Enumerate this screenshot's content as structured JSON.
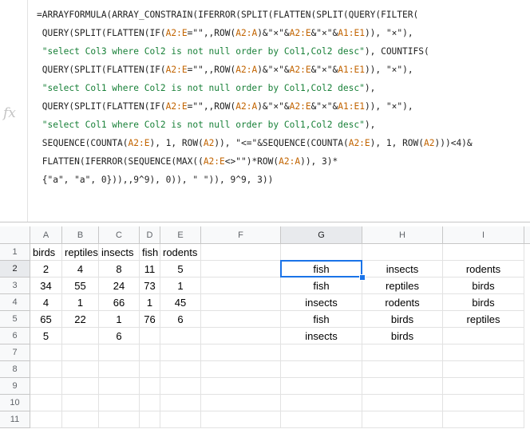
{
  "formula_lines": [
    [
      [
        "t",
        "=ARRAYFORMULA(ARRAY_CONSTRAIN(IFERROR(SPLIT(FLATTEN(SPLIT(QUERY(FILTER("
      ]
    ],
    [
      [
        "t",
        " QUERY(SPLIT(FLATTEN(IF("
      ],
      [
        "r",
        "A2:E"
      ],
      [
        "t",
        "=\"\",,ROW("
      ],
      [
        "r",
        "A2:A"
      ],
      [
        "t",
        ")&\"×\"&"
      ],
      [
        "r",
        "A2:E"
      ],
      [
        "t",
        "&\"×\"&"
      ],
      [
        "r",
        "A1:E1"
      ],
      [
        "t",
        ")), \"×\"),"
      ]
    ],
    [
      [
        "s",
        " \"select Col3 where Col2 is not null order by Col1,Col2 desc\""
      ],
      [
        "t",
        "), COUNTIFS("
      ]
    ],
    [
      [
        "t",
        " QUERY(SPLIT(FLATTEN(IF("
      ],
      [
        "r",
        "A2:E"
      ],
      [
        "t",
        "=\"\",,ROW("
      ],
      [
        "r",
        "A2:A"
      ],
      [
        "t",
        ")&\"×\"&"
      ],
      [
        "r",
        "A2:E"
      ],
      [
        "t",
        "&\"×\"&"
      ],
      [
        "r",
        "A1:E1"
      ],
      [
        "t",
        ")), \"×\"),"
      ]
    ],
    [
      [
        "s",
        " \"select Col1 where Col2 is not null order by Col1,Col2 desc\""
      ],
      [
        "t",
        "),"
      ]
    ],
    [
      [
        "t",
        " QUERY(SPLIT(FLATTEN(IF("
      ],
      [
        "r",
        "A2:E"
      ],
      [
        "t",
        "=\"\",,ROW("
      ],
      [
        "r",
        "A2:A"
      ],
      [
        "t",
        ")&\"×\"&"
      ],
      [
        "r",
        "A2:E"
      ],
      [
        "t",
        "&\"×\"&"
      ],
      [
        "r",
        "A1:E1"
      ],
      [
        "t",
        ")), \"×\"),"
      ]
    ],
    [
      [
        "s",
        " \"select Col1 where Col2 is not null order by Col1,Col2 desc\""
      ],
      [
        "t",
        "),"
      ]
    ],
    [
      [
        "t",
        " SEQUENCE(COUNTA("
      ],
      [
        "r",
        "A2:E"
      ],
      [
        "t",
        "), 1, ROW("
      ],
      [
        "r",
        "A2"
      ],
      [
        "t",
        ")), \"<=\"&SEQUENCE(COUNTA("
      ],
      [
        "r",
        "A2:E"
      ],
      [
        "t",
        "), 1, ROW("
      ],
      [
        "r",
        "A2"
      ],
      [
        "t",
        ")))<4)&"
      ]
    ],
    [
      [
        "t",
        " FLATTEN(IFERROR(SEQUENCE(MAX(("
      ],
      [
        "r",
        "A2:E"
      ],
      [
        "t",
        "<>\"\")*ROW("
      ],
      [
        "r",
        "A2:A"
      ],
      [
        "t",
        ")), 3)*"
      ]
    ],
    [
      [
        "t",
        " {\"a\", \"a\", 0})),,9^9), 0)), \" \")), 9^9, 3))"
      ]
    ]
  ],
  "fx_label": "fx",
  "columns": [
    "A",
    "B",
    "C",
    "D",
    "E",
    "F",
    "G",
    "H",
    "I"
  ],
  "rows": [
    "1",
    "2",
    "3",
    "4",
    "5",
    "6",
    "7",
    "8",
    "9",
    "10",
    "11"
  ],
  "cells": [
    [
      "birds",
      "reptiles",
      "insects",
      "fish",
      "rodents",
      "",
      "",
      "",
      ""
    ],
    [
      "2",
      "4",
      "8",
      "11",
      "5",
      "",
      "fish",
      "insects",
      "rodents"
    ],
    [
      "34",
      "55",
      "24",
      "73",
      "1",
      "",
      "fish",
      "reptiles",
      "birds"
    ],
    [
      "4",
      "1",
      "66",
      "1",
      "45",
      "",
      "insects",
      "rodents",
      "birds"
    ],
    [
      "65",
      "22",
      "1",
      "76",
      "6",
      "",
      "fish",
      "birds",
      "reptiles"
    ],
    [
      "5",
      "",
      "6",
      "",
      "",
      "",
      "insects",
      "birds",
      ""
    ],
    [
      "",
      "",
      "",
      "",
      "",
      "",
      "",
      "",
      ""
    ],
    [
      "",
      "",
      "",
      "",
      "",
      "",
      "",
      "",
      ""
    ],
    [
      "",
      "",
      "",
      "",
      "",
      "",
      "",
      "",
      ""
    ],
    [
      "",
      "",
      "",
      "",
      "",
      "",
      "",
      "",
      ""
    ],
    [
      "",
      "",
      "",
      "",
      "",
      "",
      "",
      "",
      ""
    ]
  ],
  "selected_cell": "G2",
  "colors": {
    "accent": "#1a73e8",
    "string": "#188038",
    "range": "#c26401",
    "header_bg": "#f8f9fa"
  }
}
